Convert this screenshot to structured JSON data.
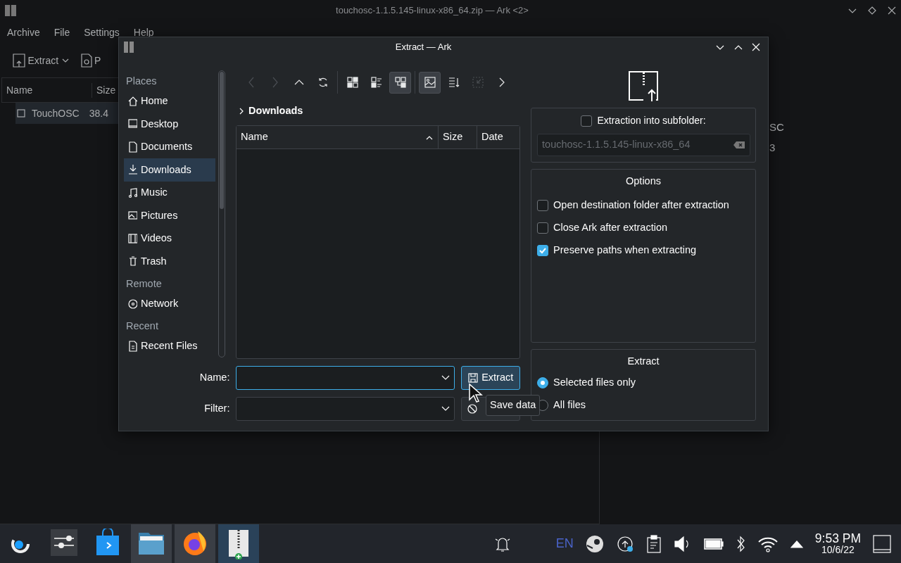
{
  "background_window": {
    "title": "touchosc-1.1.5.145-linux-x86_64.zip — Ark <2>",
    "menu": [
      "Archive",
      "File",
      "Settings",
      "Help"
    ],
    "toolbar": [
      {
        "kind": "extract",
        "label": "Extract"
      },
      {
        "kind": "preview",
        "label": "P"
      }
    ],
    "columns": [
      "Name",
      "Size"
    ],
    "rows": [
      {
        "name": "TouchOSC",
        "size": "38.4",
        "selected": true
      }
    ],
    "details": [
      "SC",
      "3"
    ]
  },
  "dialog": {
    "title": "Extract — Ark",
    "places": [
      {
        "kind": "header",
        "label": "Places"
      },
      {
        "kind": "home",
        "label": "Home",
        "selected": false
      },
      {
        "kind": "desktop",
        "label": "Desktop",
        "selected": false
      },
      {
        "kind": "documents",
        "label": "Documents",
        "selected": false
      },
      {
        "kind": "downloads",
        "label": "Downloads",
        "selected": true
      },
      {
        "kind": "music",
        "label": "Music",
        "selected": false
      },
      {
        "kind": "pictures",
        "label": "Pictures",
        "selected": false
      },
      {
        "kind": "videos",
        "label": "Videos",
        "selected": false
      },
      {
        "kind": "trash",
        "label": "Trash",
        "selected": false
      },
      {
        "kind": "header",
        "label": "Remote"
      },
      {
        "kind": "network",
        "label": "Network",
        "selected": false
      },
      {
        "kind": "header",
        "label": "Recent"
      },
      {
        "kind": "recent",
        "label": "Recent Files",
        "selected": false
      }
    ],
    "toolbar": [
      {
        "kind": "back",
        "disabled": true,
        "selected": false
      },
      {
        "kind": "forward",
        "disabled": true,
        "selected": false
      },
      {
        "kind": "up",
        "disabled": false,
        "selected": false
      },
      {
        "kind": "reload",
        "disabled": false,
        "selected": false
      },
      {
        "kind": "separator"
      },
      {
        "kind": "icons-view",
        "disabled": false,
        "selected": false
      },
      {
        "kind": "compact-view",
        "disabled": false,
        "selected": false
      },
      {
        "kind": "tree-view",
        "disabled": false,
        "selected": true
      },
      {
        "kind": "separator"
      },
      {
        "kind": "preview",
        "disabled": false,
        "selected": true
      },
      {
        "kind": "sort",
        "disabled": false,
        "selected": false
      },
      {
        "kind": "zoom",
        "disabled": true,
        "selected": false
      },
      {
        "kind": "more",
        "disabled": false,
        "selected": false
      }
    ],
    "breadcrumb": "Downloads",
    "columns": [
      "Name",
      "Size",
      "Date"
    ],
    "name_label": "Name:",
    "filter_label": "Filter:",
    "extract_button": "Extract",
    "tooltip": "Save data",
    "subfolder": {
      "label": "Extraction into subfolder:",
      "checked": false,
      "value": "touchosc-1.1.5.145-linux-x86_64"
    },
    "options": {
      "title": "Options",
      "items": [
        {
          "label": "Open destination folder after extraction",
          "checked": false
        },
        {
          "label": "Close Ark after extraction",
          "checked": false
        },
        {
          "label": "Preserve paths when extracting",
          "checked": true
        }
      ]
    },
    "extract": {
      "title": "Extract",
      "choices": [
        {
          "label": "Selected files only",
          "selected": true
        },
        {
          "label": "All files",
          "selected": false
        }
      ]
    }
  },
  "taskbar": {
    "apps": [
      {
        "kind": "launcher",
        "running": false,
        "active": false
      },
      {
        "kind": "settings",
        "running": false,
        "active": false
      },
      {
        "kind": "store",
        "running": false,
        "active": false
      },
      {
        "kind": "files",
        "running": true,
        "active": false
      },
      {
        "kind": "browser",
        "running": true,
        "active": false
      },
      {
        "kind": "archiver",
        "running": true,
        "active": true
      }
    ],
    "language": "EN",
    "time": "9:53 PM",
    "date": "10/6/22"
  }
}
